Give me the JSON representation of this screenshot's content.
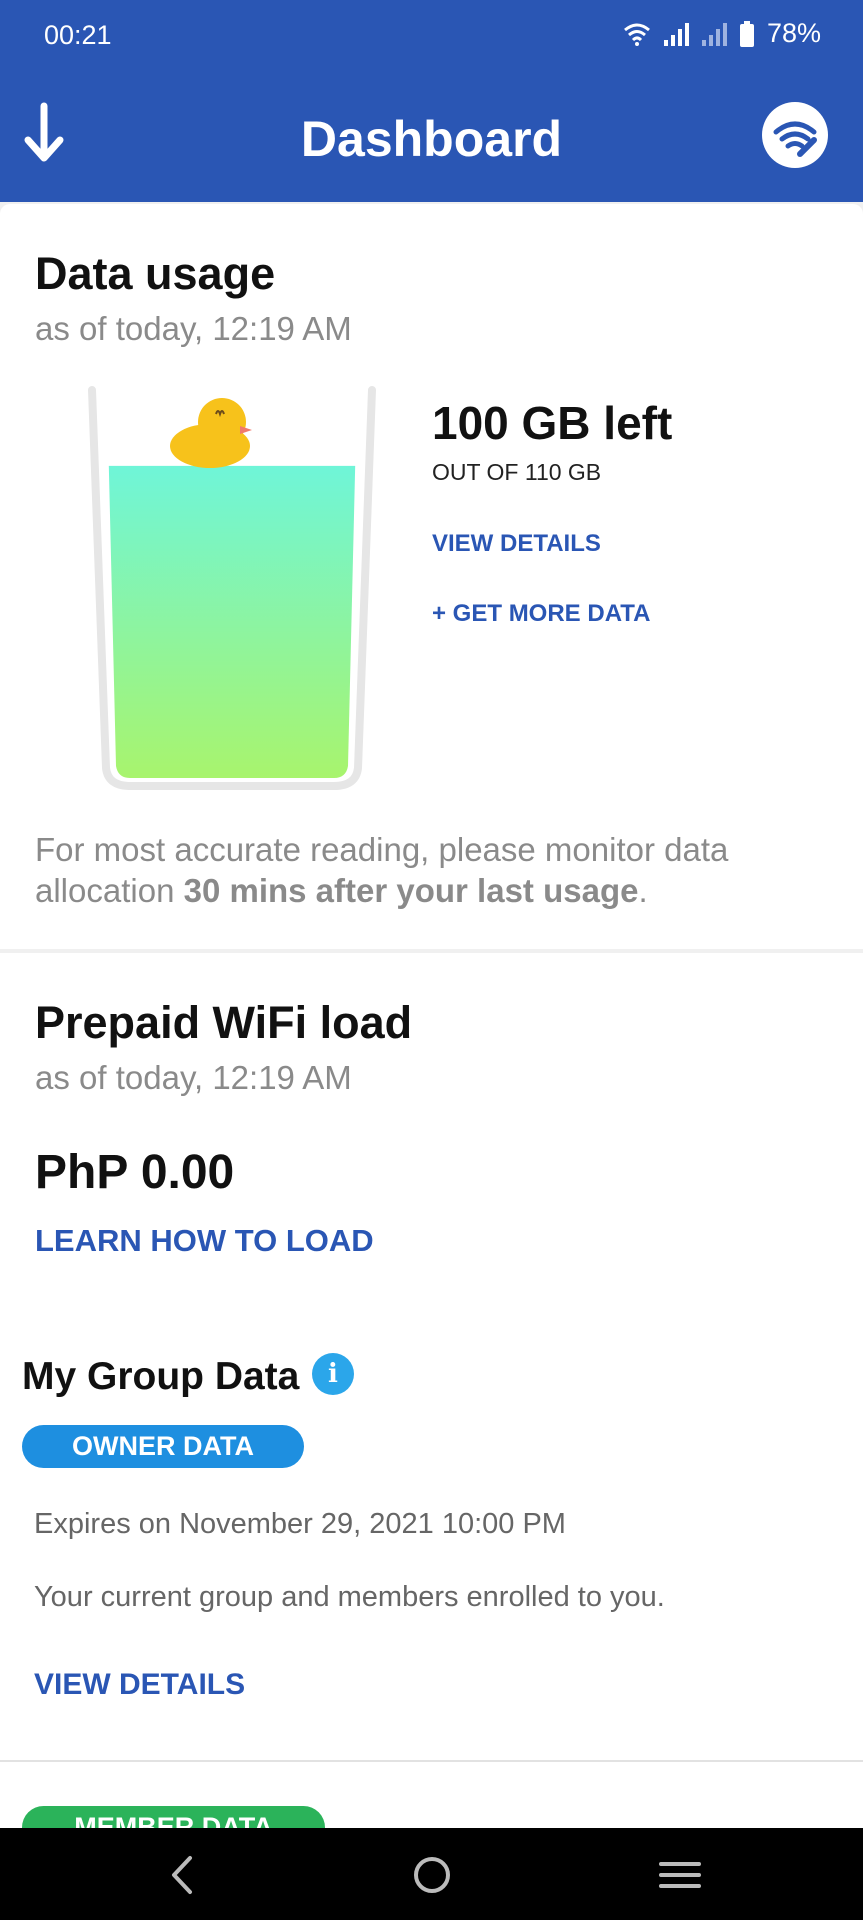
{
  "status_bar": {
    "time": "00:21",
    "battery": "78%"
  },
  "app_bar": {
    "title": "Dashboard"
  },
  "data_usage": {
    "title": "Data usage",
    "as_of": "as of today, 12:19 AM",
    "left": "100 GB left",
    "out_of": "OUT OF 110 GB",
    "remaining_fraction": 0.91,
    "view_details": "VIEW DETAILS",
    "get_more": "+ GET MORE DATA",
    "note_pre": "For most accurate reading, please monitor data allocation ",
    "note_bold": "30 mins after your last usage",
    "note_post": "."
  },
  "prepaid": {
    "title": "Prepaid WiFi load",
    "as_of": "as of today, 12:19 AM",
    "amount": "PhP 0.00",
    "learn": "LEARN HOW TO LOAD"
  },
  "group_data": {
    "title": "My Group Data",
    "info_glyph": "i",
    "owner_pill": "OWNER DATA",
    "expires": "Expires on November 29, 2021 10:00 PM",
    "description": "Your current group and members enrolled to you.",
    "view_details": "VIEW DETAILS",
    "member_pill": "MEMBER DATA"
  },
  "colors": {
    "brand_blue": "#2a56b4",
    "owner_blue": "#1e8fe0",
    "member_green": "#2bb35a",
    "liquid_top": "#6ff5d8",
    "liquid_bottom": "#a8f46d"
  },
  "icons": [
    "download-arrow-icon",
    "wifi-wrench-icon",
    "duck-icon",
    "info-icon",
    "back-icon",
    "home-icon",
    "recents-icon"
  ]
}
